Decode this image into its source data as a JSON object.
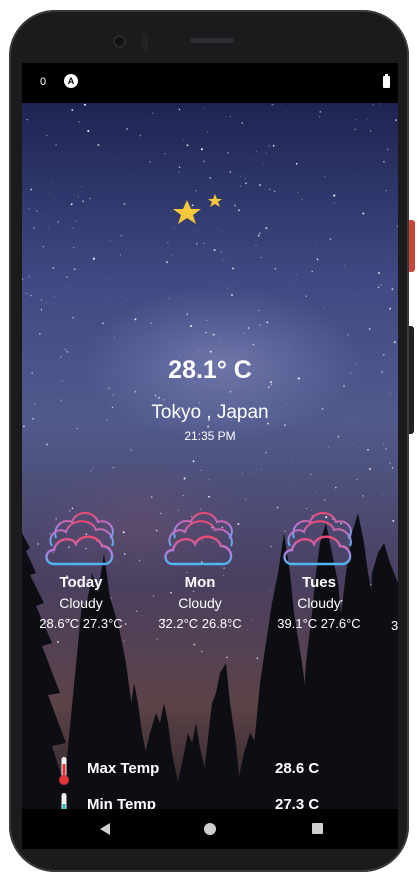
{
  "status_bar": {
    "notification_count": "0",
    "app_icon": "A"
  },
  "weather": {
    "icon": "moon-stars-icon",
    "temperature": "28.1° C",
    "location": "Tokyo ,  Japan",
    "time": "21:35 PM"
  },
  "forecast": [
    {
      "day": "Today",
      "condition": "Cloudy",
      "range": "28.6°C  27.3°C",
      "icon": "cloud-icon"
    },
    {
      "day": "Mon",
      "condition": "Cloudy",
      "range": "32.2°C  26.8°C",
      "icon": "cloud-icon"
    },
    {
      "day": "Tues",
      "condition": "Cloudy",
      "range": "39.1°C  27.6°C",
      "icon": "cloud-icon"
    }
  ],
  "forecast_cutoff": "3",
  "details": [
    {
      "label": "Max Temp",
      "value": "28.6 C",
      "icon": "thermometer-hot-icon"
    },
    {
      "label": "Min Temp",
      "value": "27.3 C",
      "icon": "thermometer-cold-icon"
    }
  ],
  "colors": {
    "moon": "#f6c73c",
    "cloud_top": "#e8507a",
    "cloud_bottom": "#4db4f0",
    "statusbar": "#000000"
  }
}
